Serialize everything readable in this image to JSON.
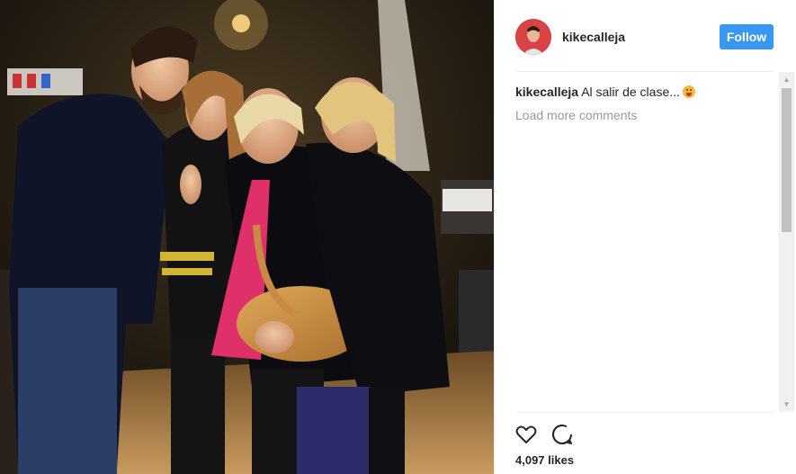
{
  "post": {
    "username": "kikecalleja",
    "follow_label": "Follow",
    "caption_user": "kikecalleja",
    "caption_text": "Al salir de clase...",
    "caption_emoji": "face-with-tongue-emoji",
    "load_more": "Load more comments",
    "likes": "4,097 likes"
  },
  "colors": {
    "follow_button": "#3897f0",
    "muted_text": "#999999",
    "text": "#262626"
  },
  "icons": {
    "like": "heart-outline-icon",
    "comment": "speech-bubble-icon"
  }
}
